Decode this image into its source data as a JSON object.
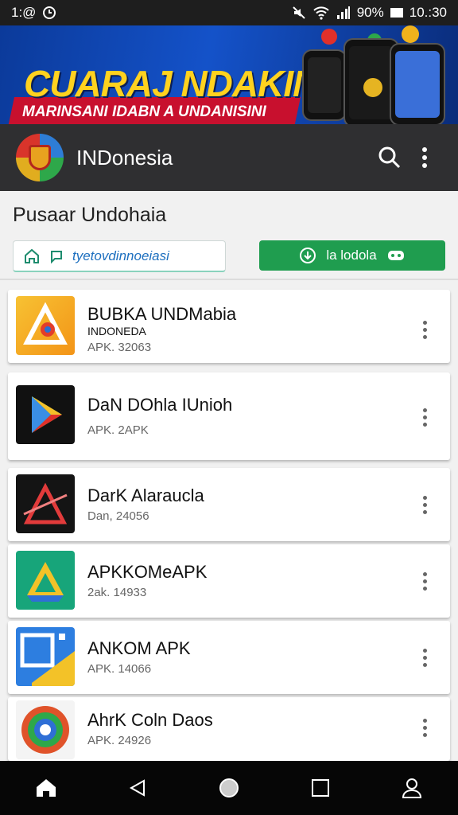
{
  "status_bar": {
    "time_left": "1:@",
    "battery": "90%",
    "clock": "10.:30"
  },
  "banner": {
    "title": "CUARAJ NDAKIN",
    "subtitle": "MARINSANI IDABN A UNDANISINI"
  },
  "app_bar": {
    "title": "INDonesia",
    "search_icon": "search-icon",
    "menu_icon": "more-vert-icon"
  },
  "section": {
    "title": "Pusaar Undohaia"
  },
  "search": {
    "value": "tyetovdinnoeiasi"
  },
  "download_button": {
    "label": "la lodola"
  },
  "apps": [
    {
      "name": "BUBKA UNDMabia",
      "subtitle": "INDONEDA",
      "meta": "APK. 32063",
      "icon": "warning-triangle-icon"
    },
    {
      "name": "DaN DOhla IUnioh",
      "subtitle": "",
      "meta": "APK. 2APK",
      "icon": "play-store-icon"
    },
    {
      "name": "DarK Alaraucla",
      "subtitle": "",
      "meta": "Dan, 24056",
      "icon": "dark-triangle-icon"
    },
    {
      "name": "APKKOMeAPK",
      "subtitle": "",
      "meta": "2ak. 14933",
      "icon": "drive-triangle-icon"
    },
    {
      "name": "ANKOM APK",
      "subtitle": "",
      "meta": "APK. 14066",
      "icon": "square-logo-icon"
    },
    {
      "name": "AhrK Coln Daos",
      "subtitle": "",
      "meta": "APK. 24926",
      "icon": "circle-logo-icon"
    }
  ],
  "nav": {
    "home_icon": "home-icon",
    "back_icon": "back-icon",
    "home_circle_icon": "home-circle-icon",
    "recents_icon": "recents-icon",
    "profile_icon": "profile-icon"
  },
  "colors": {
    "app_bar": "#2f2f31",
    "accent_green": "#1f9d4f",
    "banner_blue": "#1452c9",
    "banner_yellow": "#ffd21f",
    "banner_red": "#c8102e"
  }
}
